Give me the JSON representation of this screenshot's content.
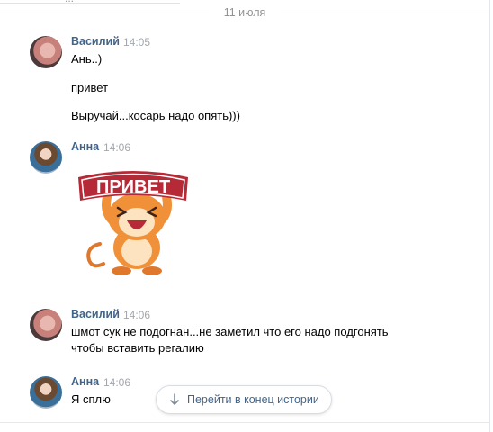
{
  "chat": {
    "top_partial_text": "...",
    "date_separator": "11 июля",
    "messages": [
      {
        "author": "Василий",
        "time": "14:05",
        "lines": [
          "Ань..)",
          "привет",
          "Выручай...косарь надо опять)))"
        ]
      },
      {
        "author": "Анна",
        "time": "14:06",
        "sticker_text": "ПРИВЕТ"
      },
      {
        "author": "Василий",
        "time": "14:06",
        "lines": [
          "шмот сук не подогнан...не заметил что его надо подгонять",
          "чтобы вставить регалию"
        ]
      },
      {
        "author": "Анна",
        "time": "14:06",
        "lines": [
          "Я сплю"
        ]
      }
    ]
  },
  "jump_button": {
    "label": "Перейти в конец истории",
    "icon": "arrow-down-icon"
  },
  "colors": {
    "author_link": "#42648b",
    "muted": "#939393",
    "separator": "#e7e8ec",
    "sticker_banner": "#b52a36",
    "sticker_body": "#f0913a"
  }
}
